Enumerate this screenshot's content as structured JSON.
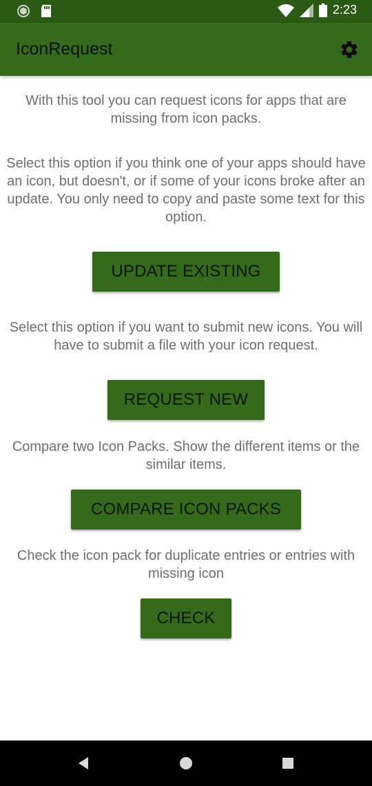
{
  "status_bar": {
    "time": "2:23",
    "icons": [
      "notification-dot-icon",
      "sd-card-icon",
      "wifi-icon",
      "signal-icon",
      "battery-icon"
    ]
  },
  "app_bar": {
    "title": "IconRequest",
    "settings_icon": "gear-icon",
    "color": "#356a1d"
  },
  "main": {
    "intro": "With this tool you can request icons for apps that are missing from icon packs.",
    "update_existing": {
      "description": "Select this option if you think one of your apps should have an icon, but doesn't, or if some of your icons broke after an update. You only need to copy and paste some text for this option.",
      "button_label": "UPDATE EXISTING"
    },
    "request_new": {
      "description": "Select this option if you want to submit new icons. You will have to submit a file with your icon request.",
      "button_label": "REQUEST NEW"
    },
    "compare": {
      "description": "Compare two Icon Packs. Show the different items or the similar items.",
      "button_label": "COMPARE ICON PACKS"
    },
    "check": {
      "description": "Check the icon pack for duplicate entries or entries with missing icon",
      "button_label": "CHECK"
    }
  },
  "nav_bar": {
    "back_icon": "back-triangle-icon",
    "home_icon": "home-circle-icon",
    "recents_icon": "recents-square-icon"
  }
}
